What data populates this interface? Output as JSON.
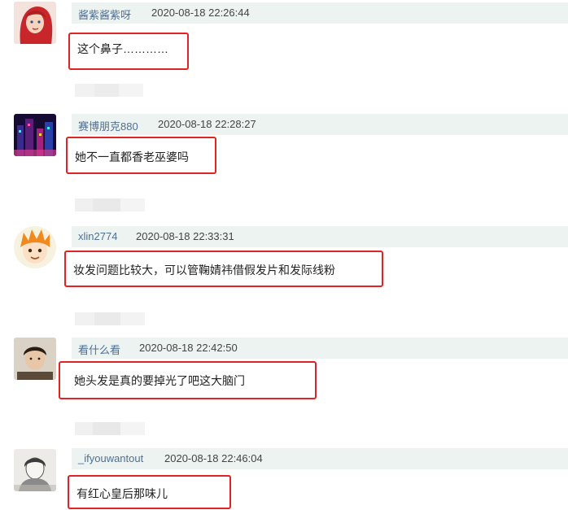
{
  "comments": [
    {
      "username": "酱紫酱紫呀",
      "time": "2020-08-18 22:26:44",
      "text": "这个鼻子…………",
      "avatar_icon": "red-hair-cartoon-avatar-icon"
    },
    {
      "username": "赛博朋克880",
      "time": "2020-08-18 22:28:27",
      "text": "她不一直都香老巫婆吗",
      "avatar_icon": "neon-city-avatar-icon"
    },
    {
      "username": "xlin2774",
      "time": "2020-08-18 22:33:31",
      "text": "妆发问题比较大，可以管鞠婧祎借假发片和发际线粉",
      "avatar_icon": "orange-hair-anime-avatar-icon"
    },
    {
      "username": "看什么看",
      "time": "2020-08-18 22:42:50",
      "text": "她头发是真的要掉光了吧这大脑门",
      "avatar_icon": "person-photo-avatar-icon"
    },
    {
      "username": "_ifyouwantout",
      "time": "2020-08-18 22:46:04",
      "text": "有红心皇后那味儿",
      "avatar_icon": "sketch-portrait-avatar-icon"
    }
  ],
  "colors": {
    "highlight_border": "#e02424",
    "meta_background": "#edf3f0",
    "username": "#4f6f93"
  }
}
